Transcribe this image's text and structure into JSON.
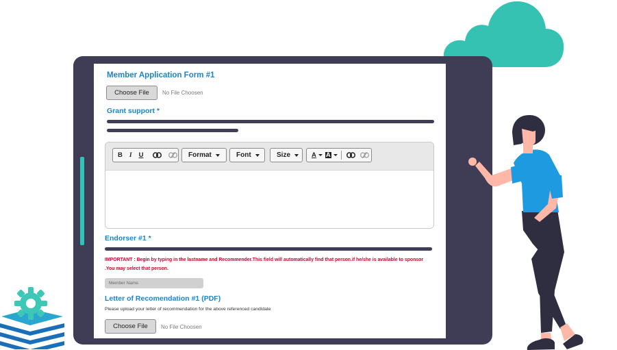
{
  "form": {
    "application_title": "Member Application Form #1",
    "choose_file_label": "Choose File",
    "no_file_text": "No File Choosen",
    "grant_label": "Grant support *",
    "editor_toolbar": {
      "bold": "B",
      "italic": "I",
      "underline": "U",
      "format": "Format",
      "font": "Font",
      "size": "Size",
      "text_color": "A",
      "bg_color": "A"
    },
    "endorser_label": "Endorser #1 *",
    "important_note": "IMPORTANT : Begin by typing in the lastname and Recommender.This field will automatically find that person.if he/she is available to sponsor .You may select that person.",
    "member_name_placeholder": "Member Name",
    "letter_title": "Letter of Recomendation  #1  (PDF)",
    "upload_note": "Please upload your letter of recommendation for the  above referenced candidate",
    "choose_file_label_2": "Choose File",
    "no_file_text_2": "No File Choosen"
  },
  "colors": {
    "accent": "#2ec4b6",
    "tablet": "#3f3d56",
    "title_blue": "#1a84c7",
    "warning_red": "#d6002a",
    "shirt_blue": "#1e9be0"
  },
  "icons": [
    "cloud-illustration",
    "gear-stack-logo",
    "link-icon",
    "unlink-icon",
    "woman-illustration"
  ]
}
